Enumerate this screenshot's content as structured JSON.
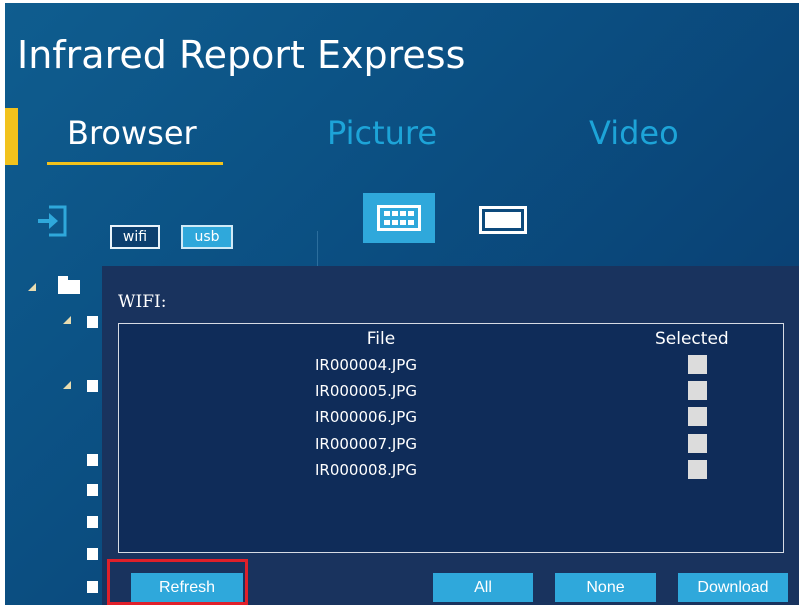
{
  "app": {
    "title": "Infrared Report Express"
  },
  "tabs": [
    {
      "label": "Browser",
      "active": true
    },
    {
      "label": "Picture",
      "active": false
    },
    {
      "label": "Video",
      "active": false
    }
  ],
  "source_toggle": {
    "wifi_label": "wifi",
    "usb_label": "usb",
    "selected": "usb"
  },
  "view_modes": {
    "grid_icon": "grid-view-icon",
    "single_icon": "single-view-icon",
    "selected": "grid"
  },
  "dialog": {
    "title": "WIFI:",
    "columns": {
      "file": "File",
      "selected": "Selected"
    },
    "rows": [
      {
        "file": "IR000004.JPG",
        "selected": false
      },
      {
        "file": "IR000005.JPG",
        "selected": false
      },
      {
        "file": "IR000006.JPG",
        "selected": false
      },
      {
        "file": "IR000007.JPG",
        "selected": false
      },
      {
        "file": "IR000008.JPG",
        "selected": false
      }
    ],
    "buttons": {
      "refresh": "Refresh",
      "all": "All",
      "none": "None",
      "download": "Download"
    }
  },
  "colors": {
    "accent": "#f2c21c",
    "tab_inactive": "#1da4d8",
    "button": "#2fa8db",
    "dialog_bg": "#19335e",
    "highlight": "#e0202a"
  }
}
